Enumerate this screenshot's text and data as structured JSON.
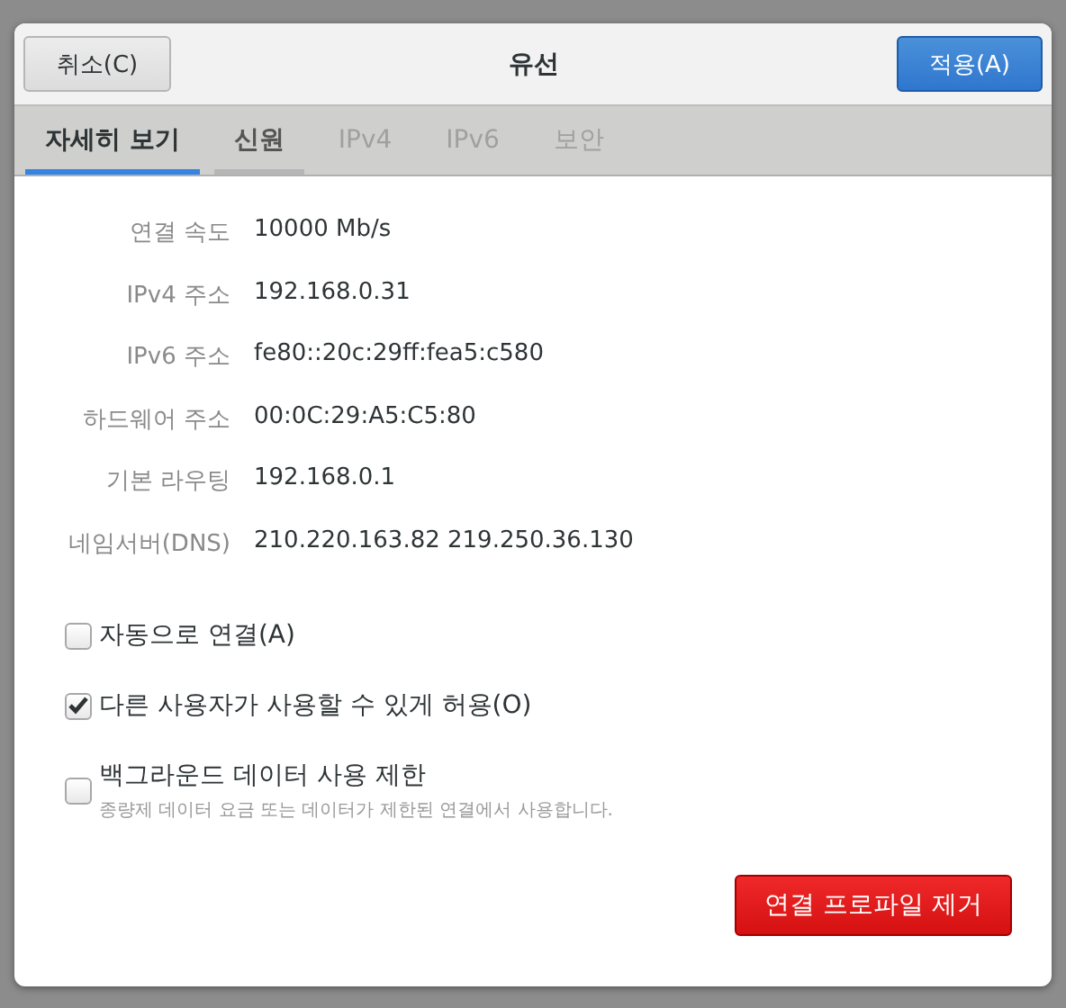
{
  "dialog": {
    "title": "유선",
    "cancel_button": "취소(C)",
    "apply_button": "적용(A)"
  },
  "tabs": [
    {
      "label": "자세히 보기",
      "selected": true,
      "disabled": false
    },
    {
      "label": "신원",
      "selected": false,
      "disabled": false
    },
    {
      "label": "IPv4",
      "selected": false,
      "disabled": true
    },
    {
      "label": "IPv6",
      "selected": false,
      "disabled": true
    },
    {
      "label": "보안",
      "selected": false,
      "disabled": true
    }
  ],
  "details": [
    {
      "label": "연결 속도",
      "value": "10000 Mb/s"
    },
    {
      "label": "IPv4 주소",
      "value": "192.168.0.31"
    },
    {
      "label": "IPv6 주소",
      "value": "fe80::20c:29ff:fea5:c580"
    },
    {
      "label": "하드웨어 주소",
      "value": "00:0C:29:A5:C5:80"
    },
    {
      "label": "기본 라우팅",
      "value": "192.168.0.1"
    },
    {
      "label": "네임서버(DNS)",
      "value": "210.220.163.82 219.250.36.130"
    }
  ],
  "options": [
    {
      "label": "자동으로 연결(A)",
      "checked": false
    },
    {
      "label": "다른 사용자가 사용할 수 있게 허용(O)",
      "checked": true
    },
    {
      "label": "백그라운드 데이터 사용 제한",
      "checked": false,
      "hint": "종량제 데이터 요금 또는 데이터가 제한된 연결에서 사용합니다."
    }
  ],
  "remove_button": "연결 프로파일 제거"
}
